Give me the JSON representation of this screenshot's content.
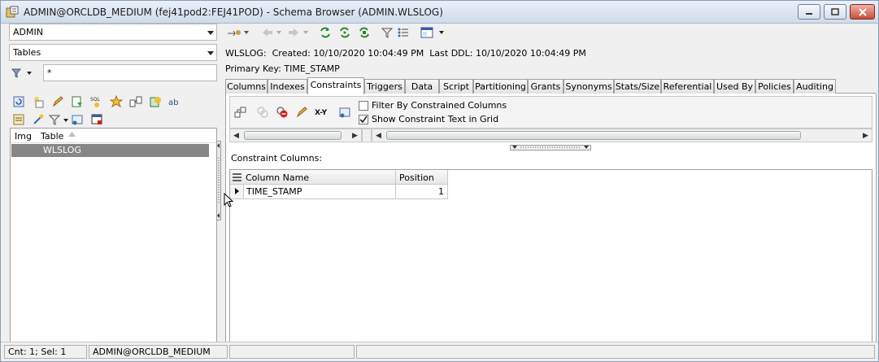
{
  "window": {
    "title": "ADMIN@ORCLDB_MEDIUM (fej41pod2:FEJ41POD) - Schema Browser (ADMIN.WLSLOG)",
    "controls": [
      "minimize-icon",
      "maximize-icon",
      "close-icon"
    ]
  },
  "left": {
    "schema_value": "ADMIN",
    "object_type_value": "Tables",
    "filter_value": "*",
    "table_list": {
      "headers": [
        "Img",
        "Table"
      ],
      "rows": [
        {
          "table": "WLSLOG",
          "selected": true
        }
      ]
    }
  },
  "right": {
    "object_info": {
      "name": "WLSLOG:",
      "created_label": "Created:",
      "created_value": "10/10/2020 10:04:49 PM",
      "last_ddl_label": "Last DDL:",
      "last_ddl_value": "10/10/2020 10:04:49 PM",
      "primary_key_label": "Primary Key:",
      "primary_key_value": "TIME_STAMP"
    },
    "tabs": [
      "Columns",
      "Indexes",
      "Constraints",
      "Triggers",
      "Data",
      "Script",
      "Partitioning",
      "Grants",
      "Synonyms",
      "Stats/Size",
      "Referential",
      "Used By",
      "Policies",
      "Auditing"
    ],
    "active_tab": "Constraints",
    "constraints": {
      "filter_checkbox_label": "Filter By Constrained Columns",
      "filter_checked": false,
      "show_text_checkbox_label": "Show Constraint Text in Grid",
      "show_text_checked": true,
      "section_label": "Constraint Columns:",
      "grid_headers": [
        "Column Name",
        "Position"
      ],
      "grid_rows": [
        {
          "column_name": "TIME_STAMP",
          "position": "1"
        }
      ]
    }
  },
  "status_bar": {
    "count": "Cnt: 1; Sel: 1",
    "connection": "ADMIN@ORCLDB_MEDIUM"
  },
  "colors": {
    "selection_row": "#868686",
    "title_bar": "#cfdbea",
    "close_button": "#c94f3b"
  }
}
